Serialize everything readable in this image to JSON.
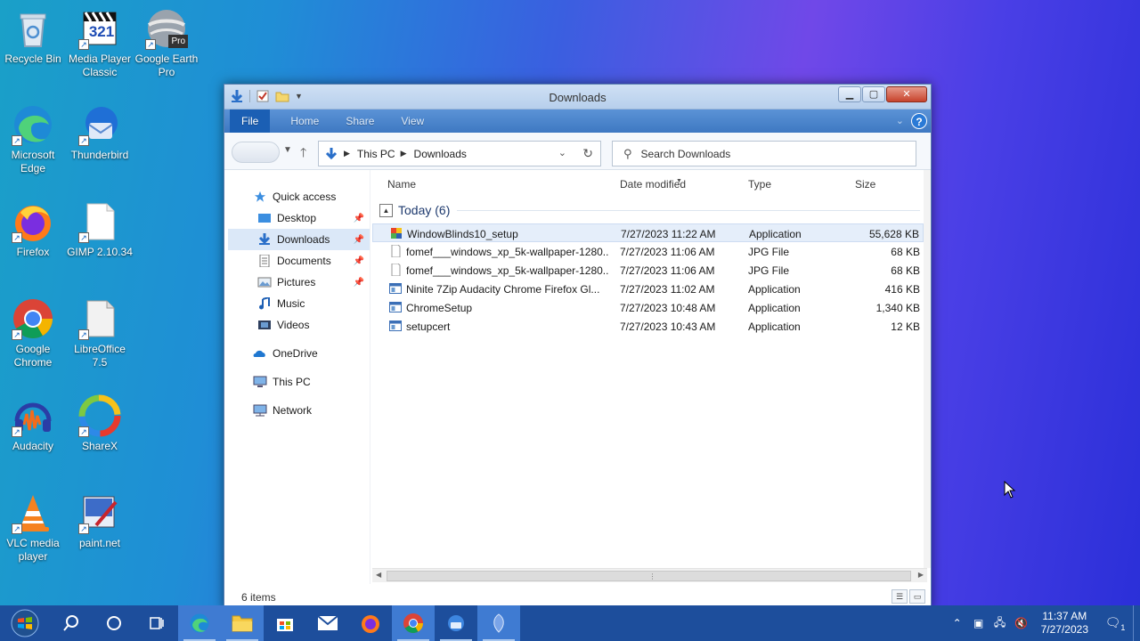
{
  "desktop": {
    "icons": [
      {
        "label": "Recycle Bin"
      },
      {
        "label": "Media Player Classic"
      },
      {
        "label": "Google Earth Pro"
      },
      {
        "label": "Microsoft Edge"
      },
      {
        "label": "Thunderbird"
      },
      {
        "label": "Firefox"
      },
      {
        "label": "GIMP 2.10.34"
      },
      {
        "label": "Google Chrome"
      },
      {
        "label": "LibreOffice 7.5"
      },
      {
        "label": "Audacity"
      },
      {
        "label": "ShareX"
      },
      {
        "label": "VLC media player"
      },
      {
        "label": "paint.net"
      }
    ],
    "mpc_badge": "321",
    "earth_badge": "Pro"
  },
  "window": {
    "title": "Downloads",
    "ribbon_tabs": [
      "File",
      "Home",
      "Share",
      "View"
    ],
    "help_label": "?",
    "breadcrumb": [
      "This PC",
      "Downloads"
    ],
    "search_placeholder": "Search Downloads",
    "sidebar": [
      {
        "label": "Quick access",
        "icon": "star-icon"
      },
      {
        "label": "Desktop",
        "icon": "desktop-folder-icon",
        "pinned": true
      },
      {
        "label": "Downloads",
        "icon": "downloads-folder-icon",
        "pinned": true,
        "selected": true
      },
      {
        "label": "Documents",
        "icon": "documents-folder-icon",
        "pinned": true
      },
      {
        "label": "Pictures",
        "icon": "pictures-folder-icon",
        "pinned": true
      },
      {
        "label": "Music",
        "icon": "music-folder-icon"
      },
      {
        "label": "Videos",
        "icon": "videos-folder-icon"
      },
      {
        "label": "OneDrive",
        "icon": "onedrive-icon"
      },
      {
        "label": "This PC",
        "icon": "computer-icon"
      },
      {
        "label": "Network",
        "icon": "network-icon"
      }
    ],
    "columns": {
      "name": "Name",
      "date": "Date modified",
      "type": "Type",
      "size": "Size"
    },
    "group_label": "Today (6)",
    "files": [
      {
        "name": "WindowBlinds10_setup",
        "date": "7/27/2023 11:22 AM",
        "type": "Application",
        "size": "55,628 KB",
        "icon": "windowblinds-icon"
      },
      {
        "name": "fomef___windows_xp_5k-wallpaper-1280...",
        "date": "7/27/2023 11:06 AM",
        "type": "JPG File",
        "size": "68 KB",
        "icon": "jpg-file-icon"
      },
      {
        "name": "fomef___windows_xp_5k-wallpaper-1280...",
        "date": "7/27/2023 11:06 AM",
        "type": "JPG File",
        "size": "68 KB",
        "icon": "jpg-file-icon"
      },
      {
        "name": "Ninite 7Zip Audacity Chrome Firefox Gl...",
        "date": "7/27/2023 11:02 AM",
        "type": "Application",
        "size": "416 KB",
        "icon": "application-icon"
      },
      {
        "name": "ChromeSetup",
        "date": "7/27/2023 10:48 AM",
        "type": "Application",
        "size": "1,340 KB",
        "icon": "application-icon"
      },
      {
        "name": "setupcert",
        "date": "7/27/2023 10:43 AM",
        "type": "Application",
        "size": "12 KB",
        "icon": "application-icon"
      }
    ],
    "status": "6 items"
  },
  "taskbar": {
    "time": "11:37 AM",
    "date": "7/27/2023",
    "notification_count": "1",
    "apps": [
      "start-icon",
      "search-icon",
      "cortana-icon",
      "task-view-icon",
      "edge-icon",
      "file-explorer-icon",
      "store-icon",
      "mail-icon",
      "firefox-icon",
      "chrome-icon",
      "thunderbird-icon",
      "windowblinds-icon"
    ]
  },
  "colors": {
    "taskbar": "#1d4e9c",
    "ribbon": "#3e78c2",
    "file_tab": "#1b5fb4",
    "selection": "#e5eefa"
  }
}
